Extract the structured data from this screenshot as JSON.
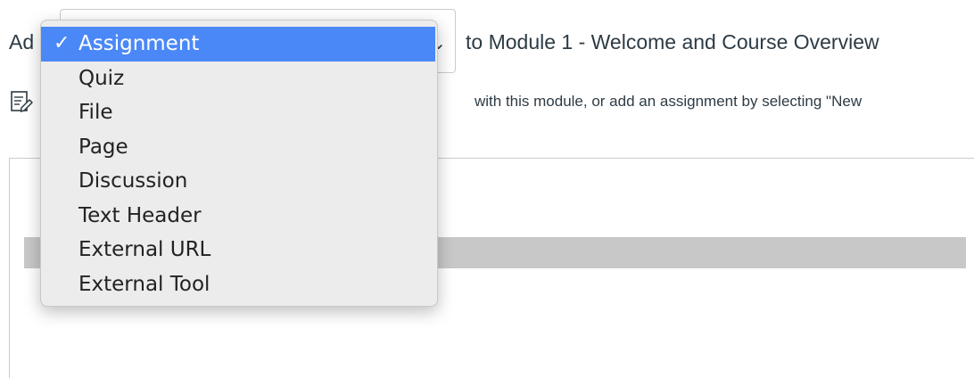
{
  "header": {
    "add_prefix": "Ad",
    "to_module_text": "to Module 1 - Welcome and Course Overview",
    "chevron_glyph": "⌄"
  },
  "instruction": {
    "icon": "edit-page-icon",
    "text": "with this module, or add an assignment by selecting \"New"
  },
  "dropdown": {
    "check_glyph": "✓",
    "selected_color": "#4b88f7",
    "items": [
      {
        "label": "Assignment",
        "selected": true
      },
      {
        "label": "Quiz",
        "selected": false
      },
      {
        "label": "File",
        "selected": false
      },
      {
        "label": "Page",
        "selected": false
      },
      {
        "label": "Discussion",
        "selected": false
      },
      {
        "label": "Text Header",
        "selected": false
      },
      {
        "label": "External URL",
        "selected": false
      },
      {
        "label": "External Tool",
        "selected": false
      }
    ]
  }
}
